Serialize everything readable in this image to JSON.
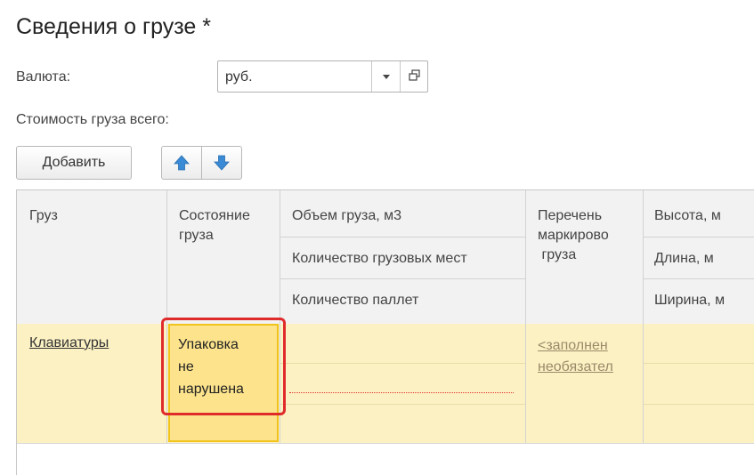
{
  "form": {
    "title": "Сведения о грузе *",
    "currency_label": "Валюта:",
    "currency_value": "руб.",
    "total_cost_label": "Стоимость груза всего:"
  },
  "toolbar": {
    "add_label": "Добавить"
  },
  "table": {
    "headers": {
      "cargo": "Груз",
      "state_line1": "Состояние",
      "state_line2": "груза",
      "volume": "Объем груза, м3",
      "places": "Количество грузовых мест",
      "pallets": "Количество паллет",
      "marking_line1": "Перечень",
      "marking_line2": "маркирово",
      "marking_line3": " груза",
      "height": "Высота, м",
      "length": "Длина, м",
      "width": "Ширина, м"
    },
    "rows": [
      {
        "cargo": "Клавиатуры",
        "state_line1": "Упаковка",
        "state_line2": "не",
        "state_line3": "нарушена",
        "marking_line1": "<заполнен",
        "marking_line2": "необязател"
      }
    ]
  },
  "colors": {
    "selected_row": "#fcf1c3",
    "current_cell": "#fde48c",
    "current_cell_border": "#f0c41c",
    "focus_highlight": "#e02b2b",
    "arrow_blue": "#3a8ad6",
    "link_placeholder": "#9a8a6a"
  },
  "icons": {
    "dropdown": "chevron-down-icon",
    "open": "open-window-icon",
    "move_up": "arrow-up-icon",
    "move_down": "arrow-down-icon"
  }
}
